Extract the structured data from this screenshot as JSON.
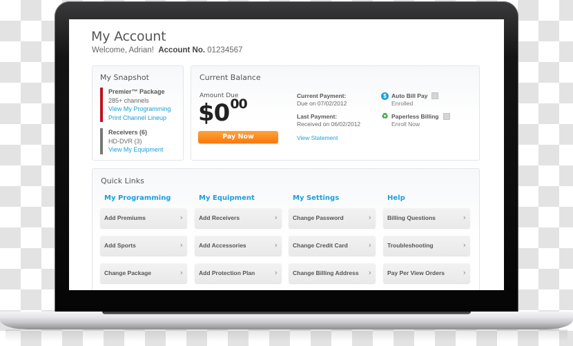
{
  "account": {
    "title": "My Account",
    "welcome": "Welcome, Adrian!",
    "account_no_label": "Account No.",
    "account_no": "01234567"
  },
  "snapshot": {
    "title": "My Snapshot",
    "groups": [
      {
        "accent": "#c0121f",
        "head": "Premier™ Package",
        "sub": "285+ channels",
        "links": [
          "View My Programming",
          "Print Channel Lineup"
        ]
      },
      {
        "accent": "#777777",
        "head": "Receivers (6)",
        "sub": "HD-DVR (3)",
        "links": [
          "View My Equipment"
        ]
      }
    ]
  },
  "balance": {
    "title": "Current Balance",
    "amount_label": "Amount Due",
    "amount_dollars": "$0",
    "amount_cents": "00",
    "pay_button": "Pay Now",
    "current_payment_label": "Current Payment:",
    "current_payment_value": "Due on 07/02/2012",
    "last_payment_label": "Last Payment:",
    "last_payment_value": "Received on 06/02/2012",
    "view_statement": "View Statement",
    "auto_bill": {
      "label": "Auto Bill Pay",
      "status": "Enrolled",
      "icon": "dollar-icon",
      "color": "#1a9fd9"
    },
    "paperless": {
      "label": "Paperless Billing",
      "status": "Enroll Now",
      "icon": "recycle-icon",
      "color": "#3aaa35"
    }
  },
  "quick_links": {
    "title": "Quick Links",
    "columns": [
      {
        "title": "My Programming",
        "items": [
          "Add Premiums",
          "Add Sports",
          "Change Package"
        ]
      },
      {
        "title": "My Equipment",
        "items": [
          "Add Receivers",
          "Add Accessories",
          "Add Protection Plan"
        ]
      },
      {
        "title": "My Settings",
        "items": [
          "Change Password",
          "Change Credit Card",
          "Change Billing Address"
        ]
      },
      {
        "title": "Help",
        "items": [
          "Billing Questions",
          "Troubleshooting",
          "Pay Per View Orders"
        ]
      }
    ]
  },
  "colors": {
    "accent_link": "#1a9fd9",
    "pay_button": "#f7790c"
  }
}
